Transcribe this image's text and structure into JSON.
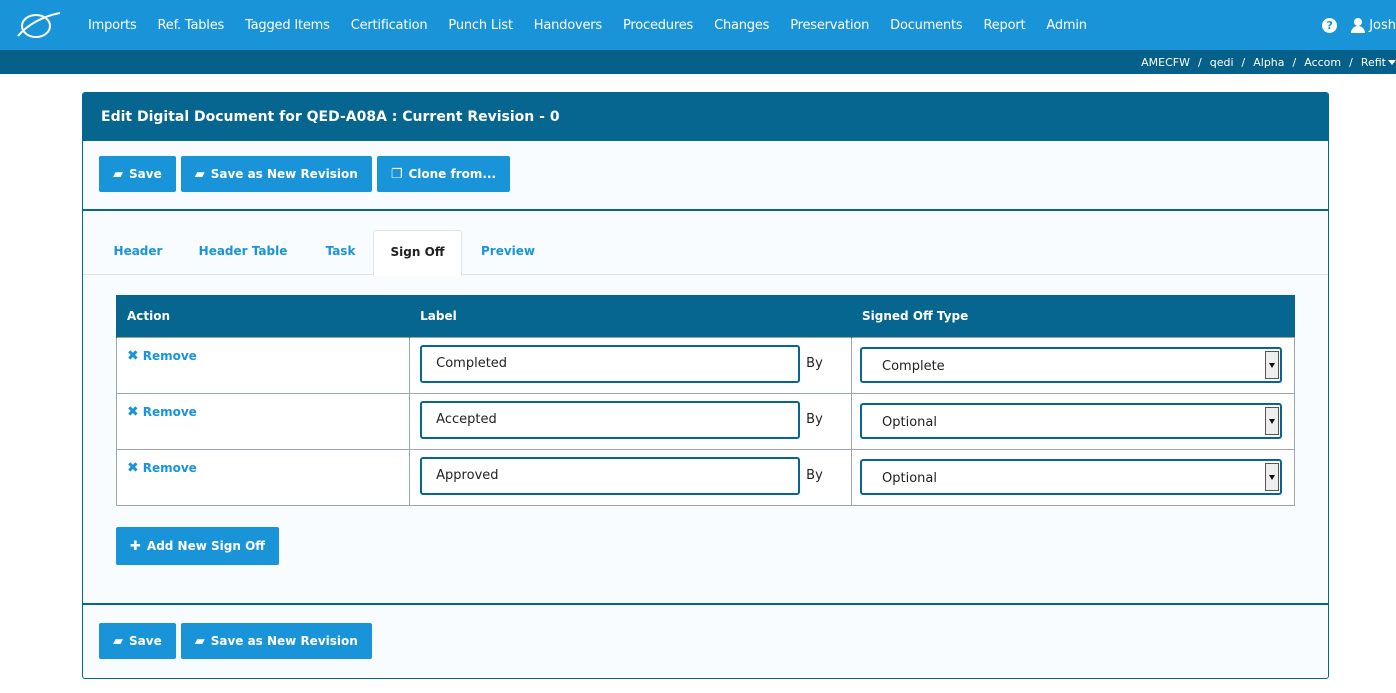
{
  "nav": {
    "items": [
      "Imports",
      "Ref. Tables",
      "Tagged Items",
      "Certification",
      "Punch List",
      "Handovers",
      "Procedures",
      "Changes",
      "Preservation",
      "Documents",
      "Report",
      "Admin"
    ],
    "help_glyph": "?",
    "user": "Josh",
    "logo_icon": "orbit-logo-icon"
  },
  "breadcrumb": [
    "AMECFW",
    "qedi",
    "Alpha",
    "Accom",
    "Refit"
  ],
  "panel": {
    "title": "Edit Digital Document for QED-A08A : Current Revision - 0"
  },
  "toolbar": {
    "save_label": "Save",
    "save_revision_label": "Save as New Revision",
    "clone_label": "Clone from..."
  },
  "tabs": [
    "Header",
    "Header Table",
    "Task",
    "Sign Off",
    "Preview"
  ],
  "active_tab": "Sign Off",
  "signoff_table": {
    "columns": [
      "Action",
      "Label",
      "Signed Off Type"
    ],
    "remove_label": "Remove",
    "by_label": "By",
    "rows": [
      {
        "label": "Completed",
        "type": "Complete"
      },
      {
        "label": "Accepted",
        "type": "Optional"
      },
      {
        "label": "Approved",
        "type": "Optional"
      }
    ]
  },
  "add_label": "Add New Sign Off",
  "footer": {
    "save_label": "Save",
    "save_revision_label": "Save as New Revision"
  },
  "colors": {
    "nav_bg": "#1a94d8",
    "subbar_bg": "#05608a",
    "panel_head": "#06668f",
    "button": "#1a94d8"
  }
}
